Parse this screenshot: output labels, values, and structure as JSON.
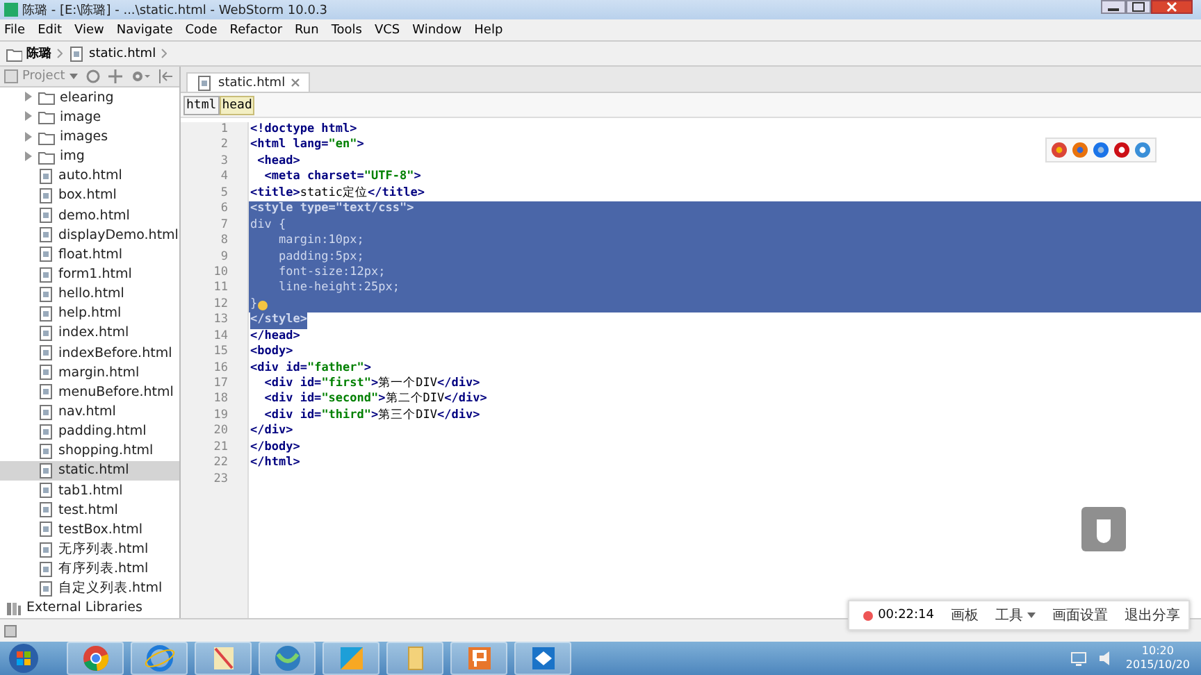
{
  "window": {
    "title": "陈璐 - [E:\\陈璐] - ...\\static.html - WebStorm 10.0.3"
  },
  "menu": [
    {
      "label": "File"
    },
    {
      "label": "Edit"
    },
    {
      "label": "View"
    },
    {
      "label": "Navigate"
    },
    {
      "label": "Code"
    },
    {
      "label": "Refactor"
    },
    {
      "label": "Run"
    },
    {
      "label": "Tools"
    },
    {
      "label": "VCS"
    },
    {
      "label": "Window"
    },
    {
      "label": "Help"
    }
  ],
  "navigation_bar": [
    {
      "label": "陈璐",
      "kind": "folder"
    },
    {
      "label": "static.html",
      "kind": "file"
    }
  ],
  "project_panel": {
    "title": "Project",
    "items": [
      {
        "label": "elearing",
        "kind": "folder",
        "expanded": false,
        "selected": false
      },
      {
        "label": "image",
        "kind": "folder",
        "expanded": false,
        "selected": false
      },
      {
        "label": "images",
        "kind": "folder",
        "expanded": false,
        "selected": false
      },
      {
        "label": "img",
        "kind": "folder",
        "expanded": false,
        "selected": false
      },
      {
        "label": "auto.html",
        "kind": "file",
        "selected": false
      },
      {
        "label": "box.html",
        "kind": "file",
        "selected": false
      },
      {
        "label": "demo.html",
        "kind": "file",
        "selected": false
      },
      {
        "label": "displayDemo.html",
        "kind": "file",
        "selected": false
      },
      {
        "label": "float.html",
        "kind": "file",
        "selected": false
      },
      {
        "label": "form1.html",
        "kind": "file",
        "selected": false
      },
      {
        "label": "hello.html",
        "kind": "file",
        "selected": false
      },
      {
        "label": "help.html",
        "kind": "file",
        "selected": false
      },
      {
        "label": "index.html",
        "kind": "file",
        "selected": false
      },
      {
        "label": "indexBefore.html",
        "kind": "file",
        "selected": false
      },
      {
        "label": "margin.html",
        "kind": "file",
        "selected": false
      },
      {
        "label": "menuBefore.html",
        "kind": "file",
        "selected": false
      },
      {
        "label": "nav.html",
        "kind": "file",
        "selected": false
      },
      {
        "label": "padding.html",
        "kind": "file",
        "selected": false
      },
      {
        "label": "shopping.html",
        "kind": "file",
        "selected": false
      },
      {
        "label": "static.html",
        "kind": "file",
        "selected": true
      },
      {
        "label": "tab1.html",
        "kind": "file",
        "selected": false
      },
      {
        "label": "test.html",
        "kind": "file",
        "selected": false
      },
      {
        "label": "testBox.html",
        "kind": "file",
        "selected": false
      },
      {
        "label": "无序列表.html",
        "kind": "file",
        "selected": false
      },
      {
        "label": "有序列表.html",
        "kind": "file",
        "selected": false
      },
      {
        "label": "自定义列表.html",
        "kind": "file",
        "selected": false
      }
    ],
    "libraries": {
      "label": "External Libraries"
    }
  },
  "editor_tabs": [
    {
      "label": "static.html",
      "selected": true
    }
  ],
  "breadcrumbs": [
    {
      "label": "html",
      "selected": false
    },
    {
      "label": "head",
      "selected": true
    }
  ],
  "code": [
    {
      "number": "1",
      "kind": "plain",
      "selected": false,
      "segments": [
        {
          "kind": "tag",
          "text": "<!doctype html>"
        }
      ]
    },
    {
      "number": "2",
      "kind": "plain",
      "selected": false,
      "segments": [
        {
          "kind": "tag",
          "text": "<html lang="
        },
        {
          "kind": "value",
          "text": "\"en\""
        },
        {
          "kind": "tag",
          "text": ">"
        }
      ]
    },
    {
      "number": "3",
      "kind": "plain",
      "selected": false,
      "segments": [
        {
          "kind": "tag",
          "text": " <head>"
        }
      ]
    },
    {
      "number": "4",
      "kind": "plain",
      "selected": false,
      "segments": [
        {
          "kind": "tag",
          "text": "  <meta charset="
        },
        {
          "kind": "value",
          "text": "\"UTF-8\""
        },
        {
          "kind": "tag",
          "text": ">"
        }
      ]
    },
    {
      "number": "5",
      "kind": "plain",
      "selected": false,
      "segments": [
        {
          "kind": "tag",
          "text": "<title>"
        },
        {
          "kind": "text",
          "text": "static定位"
        },
        {
          "kind": "tag",
          "text": "</title>"
        }
      ]
    },
    {
      "number": "6",
      "kind": "plain",
      "selected": true,
      "segments": [
        {
          "kind": "tag",
          "text": "<style type="
        },
        {
          "kind": "value",
          "text": "\"text/css\""
        },
        {
          "kind": "tag",
          "text": ">"
        }
      ]
    },
    {
      "number": "7",
      "kind": "plain",
      "selected": true,
      "segments": [
        {
          "kind": "text",
          "text": "div {"
        }
      ]
    },
    {
      "number": "8",
      "kind": "plain",
      "selected": true,
      "segments": [
        {
          "kind": "text",
          "text": "    margin:10px;"
        }
      ]
    },
    {
      "number": "9",
      "kind": "plain",
      "selected": true,
      "segments": [
        {
          "kind": "text",
          "text": "    padding:5px;"
        }
      ]
    },
    {
      "number": "10",
      "kind": "plain",
      "selected": true,
      "segments": [
        {
          "kind": "text",
          "text": "    font-size:12px;"
        }
      ]
    },
    {
      "number": "11",
      "kind": "plain",
      "selected": true,
      "segments": [
        {
          "kind": "text",
          "text": "    line-height:25px;"
        }
      ]
    },
    {
      "number": "12",
      "kind": "bulb",
      "selected": true,
      "segments": [
        {
          "kind": "text",
          "text": "}"
        }
      ]
    },
    {
      "number": "13",
      "kind": "plain",
      "selected": true,
      "segments": [
        {
          "kind": "tag",
          "text": "</style>"
        }
      ]
    },
    {
      "number": "14",
      "kind": "plain",
      "selected": false,
      "segments": [
        {
          "kind": "tag",
          "text": "</head>"
        }
      ]
    },
    {
      "number": "15",
      "kind": "plain",
      "selected": false,
      "segments": [
        {
          "kind": "tag",
          "text": "<body>"
        }
      ]
    },
    {
      "number": "16",
      "kind": "plain",
      "selected": false,
      "segments": [
        {
          "kind": "tag",
          "text": "<div id="
        },
        {
          "kind": "value",
          "text": "\"father\""
        },
        {
          "kind": "tag",
          "text": ">"
        }
      ]
    },
    {
      "number": "17",
      "kind": "plain",
      "selected": false,
      "segments": [
        {
          "kind": "tag",
          "text": "  <div id="
        },
        {
          "kind": "value",
          "text": "\"first\""
        },
        {
          "kind": "tag",
          "text": ">"
        },
        {
          "kind": "text",
          "text": "第一个DIV"
        },
        {
          "kind": "tag",
          "text": "</div>"
        }
      ]
    },
    {
      "number": "18",
      "kind": "plain",
      "selected": false,
      "segments": [
        {
          "kind": "tag",
          "text": "  <div id="
        },
        {
          "kind": "value",
          "text": "\"second\""
        },
        {
          "kind": "tag",
          "text": ">"
        },
        {
          "kind": "text",
          "text": "第二个DIV"
        },
        {
          "kind": "tag",
          "text": "</div>"
        }
      ]
    },
    {
      "number": "19",
      "kind": "plain",
      "selected": false,
      "segments": [
        {
          "kind": "tag",
          "text": "  <div id="
        },
        {
          "kind": "value",
          "text": "\"third\""
        },
        {
          "kind": "tag",
          "text": ">"
        },
        {
          "kind": "text",
          "text": "第三个DIV"
        },
        {
          "kind": "tag",
          "text": "</div>"
        }
      ]
    },
    {
      "number": "20",
      "kind": "plain",
      "selected": false,
      "segments": [
        {
          "kind": "tag",
          "text": "</div>"
        }
      ]
    },
    {
      "number": "21",
      "kind": "plain",
      "selected": false,
      "segments": [
        {
          "kind": "tag",
          "text": "</body>"
        }
      ]
    },
    {
      "number": "22",
      "kind": "plain",
      "selected": false,
      "segments": [
        {
          "kind": "tag",
          "text": "</html>"
        }
      ]
    },
    {
      "number": "23",
      "kind": "plain"
    }
  ],
  "share_toolbar": {
    "timer": "00:22:14",
    "buttons": [
      {
        "label": "画板",
        "kind": "plain"
      },
      {
        "label": "工具",
        "kind": "dropdown"
      },
      {
        "label": "画面设置",
        "kind": "plain"
      },
      {
        "label": "退出分享",
        "kind": "plain"
      }
    ]
  },
  "taskbar": {
    "time": "10:20",
    "date": "2015/10/20"
  }
}
